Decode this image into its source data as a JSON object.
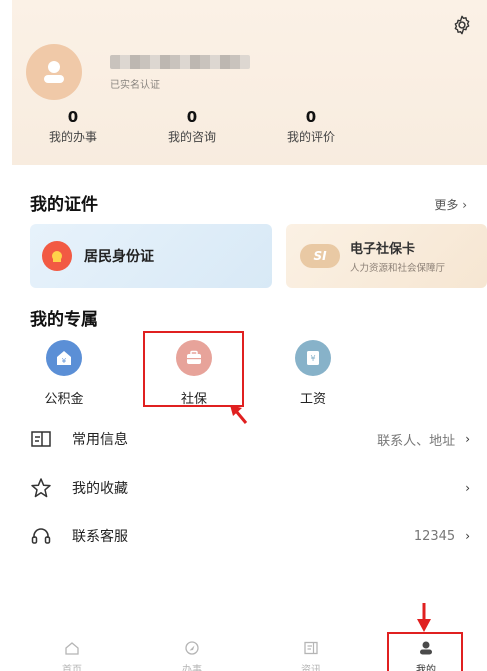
{
  "profile": {
    "verified_text": "已实名认证",
    "stats": [
      {
        "value": "0",
        "label": "我的办事"
      },
      {
        "value": "0",
        "label": "我的咨询"
      },
      {
        "value": "0",
        "label": "我的评价"
      }
    ]
  },
  "certificates": {
    "title": "我的证件",
    "more": "更多 ›",
    "id_card": "居民身份证",
    "social_card_title": "电子社保卡",
    "social_card_sub": "人力资源和社会保障厅",
    "social_card_logo": "SI"
  },
  "exclusive": {
    "title": "我的专属",
    "items": [
      {
        "label": "公积金",
        "icon": "housing-fund-icon"
      },
      {
        "label": "社保",
        "icon": "briefcase-icon"
      },
      {
        "label": "工资",
        "icon": "salary-icon"
      }
    ]
  },
  "menu": [
    {
      "label": "常用信息",
      "value": "联系人、地址",
      "chevron": "›"
    },
    {
      "label": "我的收藏",
      "value": "",
      "chevron": "›"
    },
    {
      "label": "联系客服",
      "value": "12345",
      "chevron": "›"
    }
  ],
  "tabs": [
    {
      "label": "首页"
    },
    {
      "label": "办事"
    },
    {
      "label": "资讯"
    },
    {
      "label": "我的"
    }
  ],
  "colors": {
    "accent_red": "#e02020",
    "card_bg": "#fbf1e6"
  }
}
